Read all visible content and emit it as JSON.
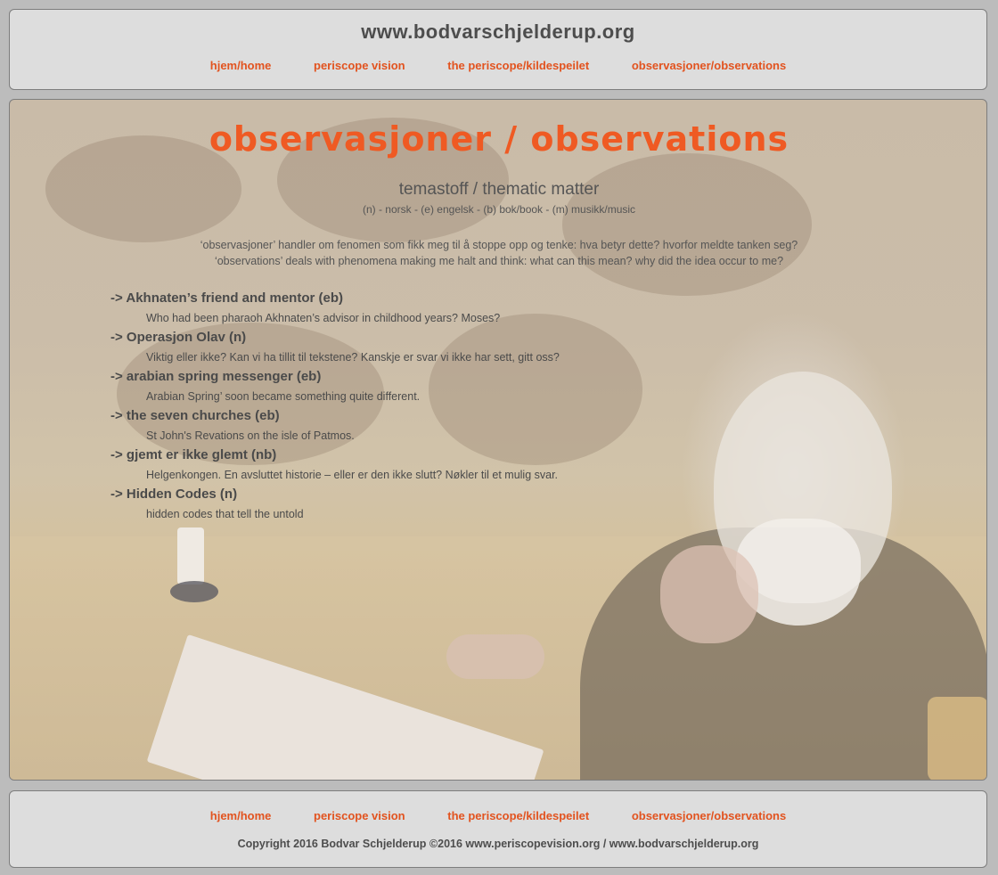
{
  "header": {
    "site_title": "www.bodvarschjelderup.org",
    "nav": [
      {
        "label": "hjem/home"
      },
      {
        "label": "periscope vision"
      },
      {
        "label": "the periscope/kildespeilet"
      },
      {
        "label": "observasjoner/observations"
      }
    ]
  },
  "main": {
    "title": "observasjoner / observations",
    "subtitle": "temastoff / thematic matter",
    "legend": "(n) - norsk - (e) engelsk - (b) bok/book - (m) musikk/music",
    "intro_no": "‘observasjoner’ handler om fenomen som fikk meg til å stoppe opp og tenke: hva betyr dette? hvorfor meldte tanken seg?",
    "intro_en": "‘observations’ deals with phenomena making me halt and think: what can this mean? why did the idea occur to me?",
    "items": [
      {
        "title": "-> Akhnaten’s friend and mentor (eb)",
        "desc": "Who had been pharaoh Akhnaten’s advisor in childhood years? Moses?"
      },
      {
        "title": "-> Operasjon Olav (n)",
        "desc": "Viktig eller ikke? Kan vi ha tillit til tekstene? Kanskje er svar vi ikke har sett, gitt oss?"
      },
      {
        "title": "-> arabian spring messenger (eb)",
        "desc": "Arabian Spring’ soon became something quite different."
      },
      {
        "title": "-> the seven churches (eb)",
        "desc": "St John's Revations on the isle of Patmos."
      },
      {
        "title": "-> gjemt er ikke glemt (nb)",
        "desc": "Helgenkongen. En avsluttet historie – eller er den ikke slutt? Nøkler til et mulig svar."
      },
      {
        "title": "-> Hidden Codes (n)",
        "desc": "hidden codes that tell the untold"
      }
    ]
  },
  "footer": {
    "nav": [
      {
        "label": "hjem/home"
      },
      {
        "label": "periscope vision"
      },
      {
        "label": "the periscope/kildespeilet"
      },
      {
        "label": "observasjoner/observations"
      }
    ],
    "copyright": "Copyright 2016 Bodvar Schjelderup ©2016   www.periscopevision.org / www.bodvarschjelderup.org"
  },
  "colors": {
    "accent": "#ef5a23",
    "nav_link": "#e2531f",
    "panel_bg": "#dddddd",
    "page_bg": "#bcbcbc"
  }
}
